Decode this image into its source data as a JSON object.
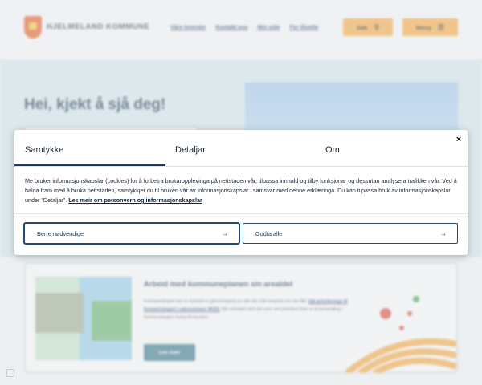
{
  "header": {
    "brand": "HJELMELAND KOMMUNE",
    "nav": [
      "Våre tenester",
      "Kontakt oss",
      "Min side",
      "For tilsette"
    ],
    "search_label": "Søk",
    "menu_label": "Meny"
  },
  "hero": {
    "title": "Hei, kjekt å sjå deg!"
  },
  "card": {
    "title": "Arbeid med kommuneplanen sin arealdel",
    "text_before": "Formannskapet har no fastsett ei gjennomgang av alle dei 138 innspela me har fått.",
    "text_link": "Sjå prioriteringa til formannskapet i saksnummer 40/25.",
    "text_after": "Når arbeidet med dei som vert prioritert fram er til behandling i formannskapet, truleg til hausten.",
    "button_label": "Les meir"
  },
  "consent": {
    "tabs": [
      "Samtykke",
      "Detaljar",
      "Om"
    ],
    "active_tab": "Samtykke",
    "close_label": "×",
    "body": "Me bruker informasjonskapslar (cookies) for å forbetra brukaropplevinga på nettstaden vår, tilpassa innhald og tilby funksjonar og dessutan analysera trafikken vår. Ved å halda fram med å bruka nettstaden, samtykkjer du til bruken vår av informasjonskapslar i samsvar med denne erklæringa. Du kan tilpassa bruk av informasjonskapslar under \"Detaljar\".",
    "link": "Les meir om personvern og informasjonskapslar",
    "buttons": {
      "necessary": "Berre nødvendige",
      "accept_all": "Godta alle"
    }
  },
  "colors": {
    "accent_orange": "#f2a43a",
    "brand_navy": "#1b3b63",
    "hero_bg": "#cfe4ea",
    "button_teal": "#2f7186"
  }
}
